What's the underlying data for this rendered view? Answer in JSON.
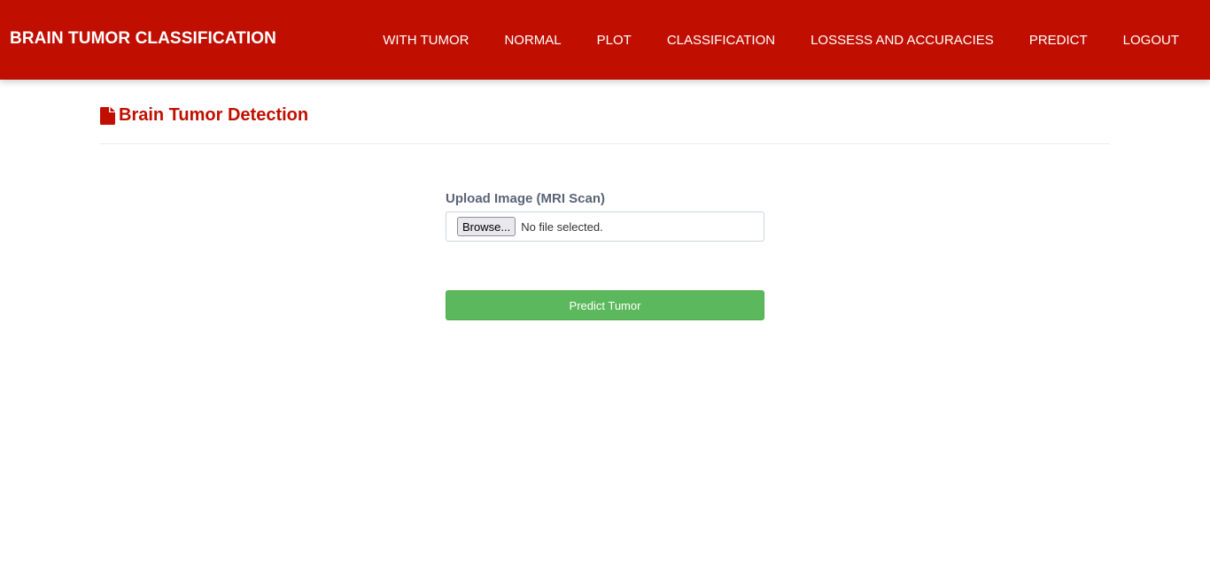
{
  "navbar": {
    "brand": "BRAIN TUMOR CLASSIFICATION",
    "background": "#c00f00",
    "links": [
      {
        "label": "WITH TUMOR"
      },
      {
        "label": "NORMAL"
      },
      {
        "label": "PLOT"
      },
      {
        "label": "CLASSIFICATION"
      },
      {
        "label": "LOSSESS AND ACCURACIES"
      },
      {
        "label": "PREDICT"
      },
      {
        "label": "LOGOUT"
      }
    ]
  },
  "page": {
    "icon": "file-icon",
    "title": "Brain Tumor Detection"
  },
  "form": {
    "upload_label": "Upload Image (MRI Scan)",
    "browse_label": "Browse...",
    "file_status": "No file selected.",
    "submit_label": "Predict Tumor",
    "submit_color": "#5cb85c"
  }
}
